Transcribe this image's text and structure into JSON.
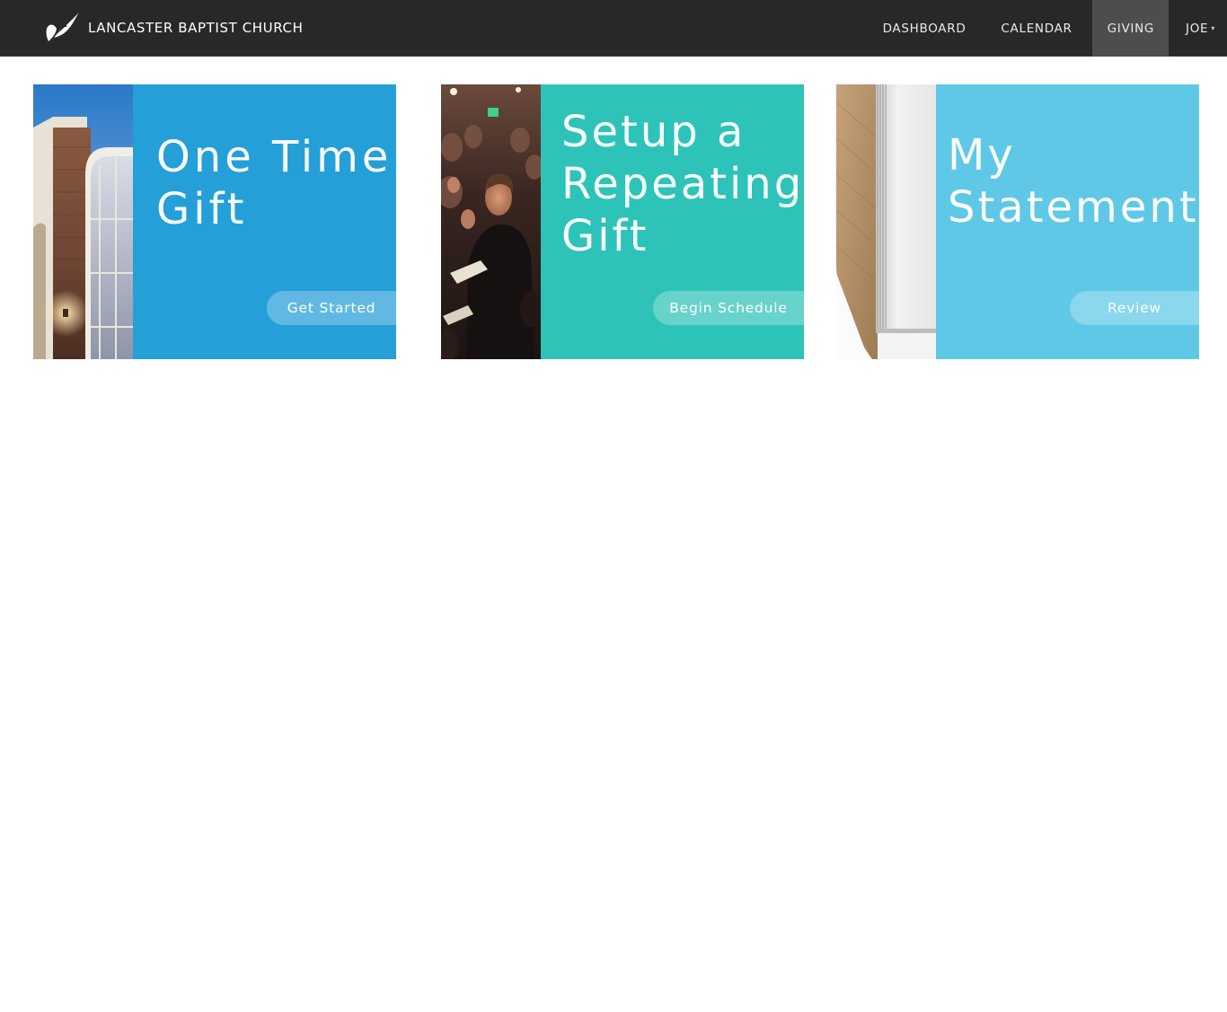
{
  "header": {
    "brand_name": "LANCASTER BAPTIST CHURCH",
    "logo_icon": "leaf-cross-icon",
    "nav": {
      "dashboard": "DASHBOARD",
      "calendar": "CALENDAR",
      "giving": "GIVING",
      "user": "JOE"
    },
    "active_item": "GIVING",
    "colors": {
      "bar": "#282828",
      "active": "#4d4d4d"
    }
  },
  "cards": [
    {
      "title": "One Time\nGift",
      "action_label": "Get Started",
      "color": "#259fd8",
      "photo": "church-building-photo"
    },
    {
      "title": "Setup a\nRepeating\nGift",
      "action_label": "Begin Schedule",
      "color": "#2ec3b8",
      "photo": "congregation-photo"
    },
    {
      "title": "My\nStatements",
      "action_label": "Review",
      "color": "#5fc8e6",
      "photo": "envelope-photo"
    }
  ]
}
